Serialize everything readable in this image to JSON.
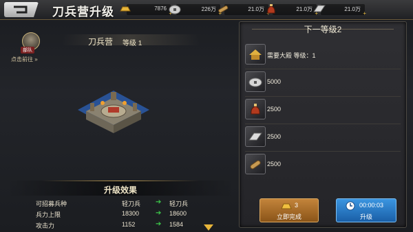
{
  "header": {
    "title": "刀兵营升级",
    "resources": [
      {
        "icon": "gold-ingot-icon",
        "value": "7876",
        "plus": "+"
      },
      {
        "icon": "silver-coin-icon",
        "value": "226万",
        "plus": "+"
      },
      {
        "icon": "wood-log-icon",
        "value": "21.0万",
        "plus": "+"
      },
      {
        "icon": "grain-sack-icon",
        "value": "21.0万",
        "plus": "+"
      },
      {
        "icon": "iron-ingot-icon",
        "value": "21.0万",
        "plus": "+"
      }
    ]
  },
  "left": {
    "avatar_tag": "部队",
    "goto_label": "点击前往 »",
    "building_name": "刀兵营",
    "building_level": "等级 1",
    "effects_title": "升级效果",
    "effects": [
      {
        "label": "可招募兵种",
        "current": "轻刀兵",
        "next": "轻刀兵"
      },
      {
        "label": "兵力上限",
        "current": "18300",
        "next": "18600"
      },
      {
        "label": "攻击力",
        "current": "1152",
        "next": "1584"
      }
    ]
  },
  "right": {
    "title": "下一等级2",
    "requirements": [
      {
        "icon": "palace-icon",
        "text": "需要大殿 等级：1"
      },
      {
        "icon": "silver-coin-icon",
        "text": "5000"
      },
      {
        "icon": "grain-sack-icon",
        "text": "2500"
      },
      {
        "icon": "iron-ingot-icon",
        "text": "2500"
      },
      {
        "icon": "wood-log-icon",
        "text": "2500"
      }
    ],
    "instant": {
      "cost": "3",
      "label": "立即完成"
    },
    "upgrade": {
      "time": "00:00:03",
      "label": "升级"
    }
  },
  "colors": {
    "accent_gold": "#c9a55a",
    "arrow_green": "#3cc84a",
    "button_orange": "#b07030",
    "button_blue": "#2a7fd0"
  }
}
